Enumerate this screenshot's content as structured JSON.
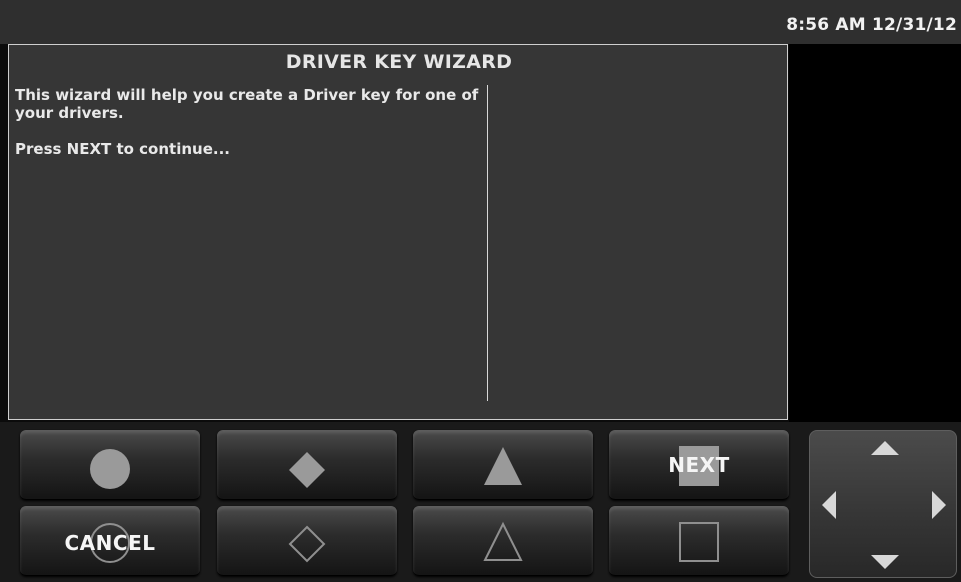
{
  "status": {
    "clock": "8:56 AM 12/31/12"
  },
  "wizard": {
    "title": "DRIVER KEY WIZARD",
    "intro": "This wizard will help you create a Driver key for one of your drivers.",
    "prompt": "Press NEXT to continue..."
  },
  "softkeys": {
    "next_label": "NEXT",
    "cancel_label": "CANCEL",
    "icons": [
      "circle-filled",
      "diamond-filled",
      "triangle-filled",
      "square-filled",
      "circle-outline",
      "diamond-outline",
      "triangle-outline",
      "square-outline"
    ]
  },
  "dpad": {
    "icons": [
      "arrow-up",
      "arrow-down",
      "arrow-left",
      "arrow-right"
    ]
  },
  "colors": {
    "panel": "#363636",
    "topbar": "#2f2f2f",
    "icon_fill": "#9a9a9a"
  }
}
